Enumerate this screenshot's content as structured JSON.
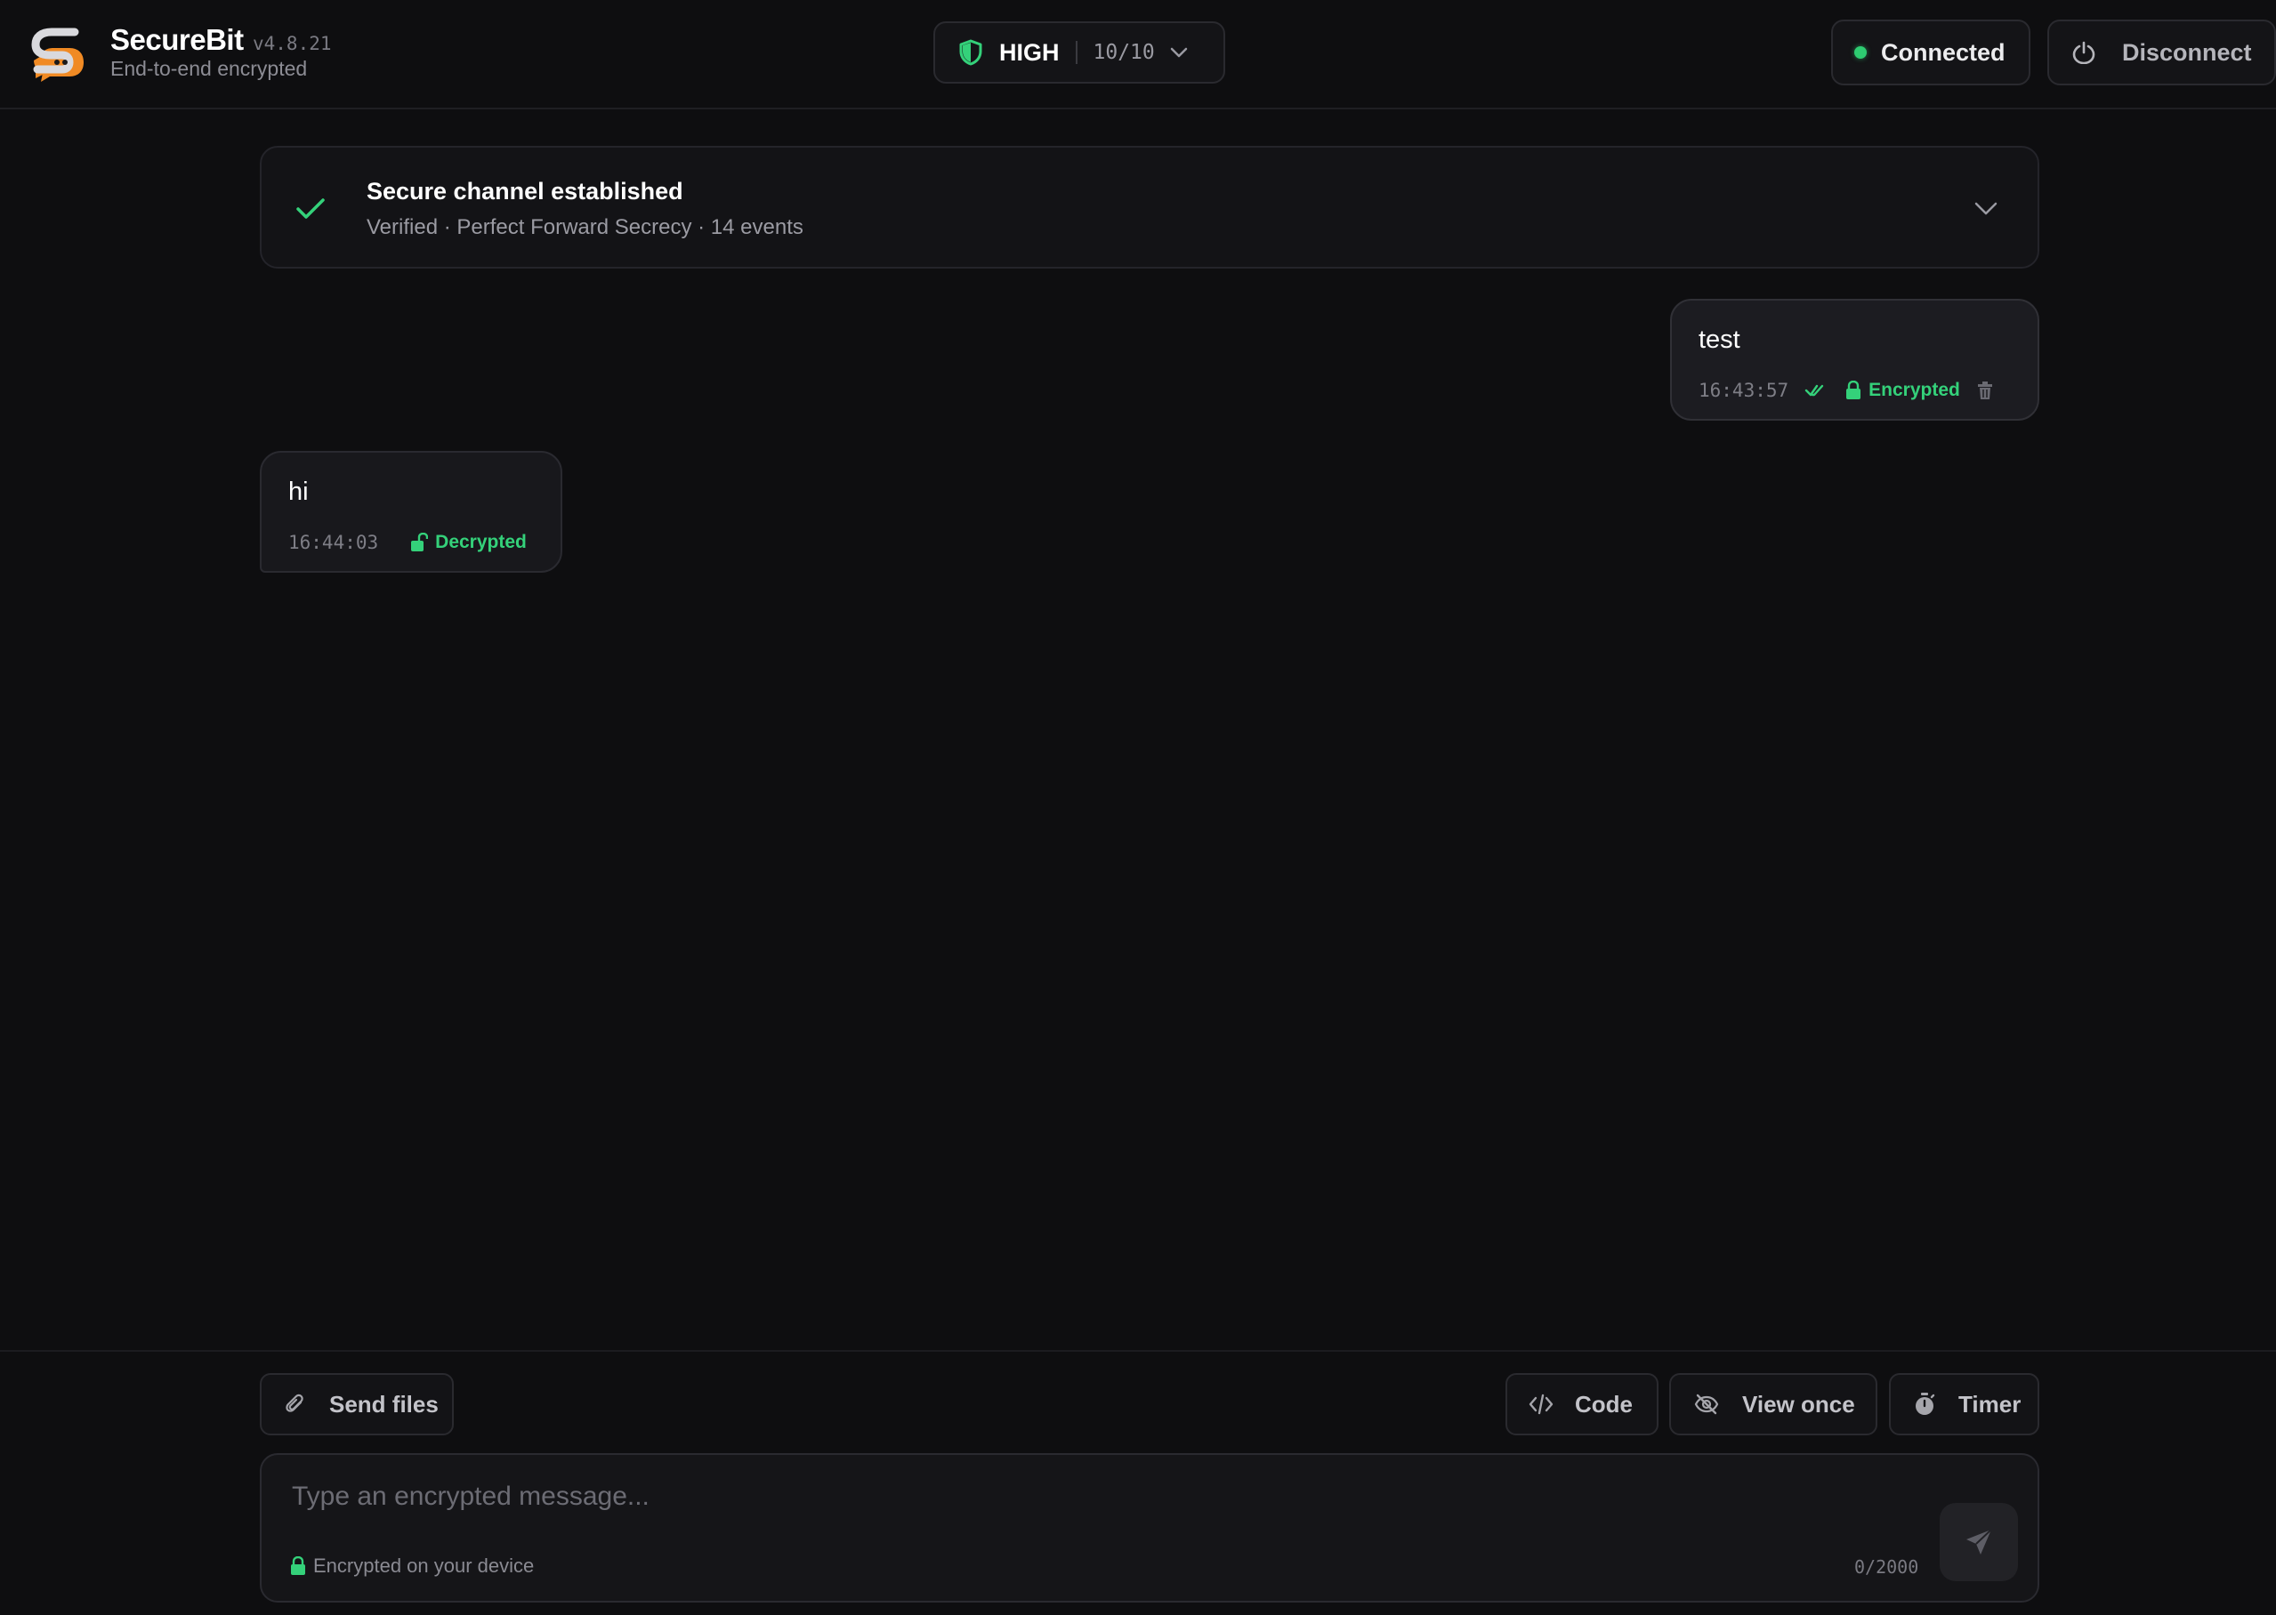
{
  "app": {
    "name": "SecureBit",
    "version": "v4.8.21",
    "subtitle": "End-to-end encrypted"
  },
  "security": {
    "level": "HIGH",
    "score": "10/10",
    "icon": "shield-icon"
  },
  "connection": {
    "status_label": "Connected",
    "disconnect_label": "Disconnect"
  },
  "banner": {
    "title": "Secure channel established",
    "details": "Verified · Perfect Forward Secrecy · 14 events"
  },
  "messages": [
    {
      "direction": "outgoing",
      "text": "test",
      "time": "16:43:57",
      "status": "Encrypted"
    },
    {
      "direction": "incoming",
      "text": "hi",
      "time": "16:44:03",
      "status": "Decrypted"
    }
  ],
  "composer": {
    "send_files_label": "Send files",
    "code_label": "Code",
    "view_once_label": "View once",
    "timer_label": "Timer",
    "placeholder": "Type an encrypted message...",
    "value": "",
    "note": "Encrypted on your device",
    "counter": "0/2000"
  },
  "colors": {
    "background": "#0e0e10",
    "accent_green": "#34d17a",
    "brand_orange": "#f08a24"
  }
}
